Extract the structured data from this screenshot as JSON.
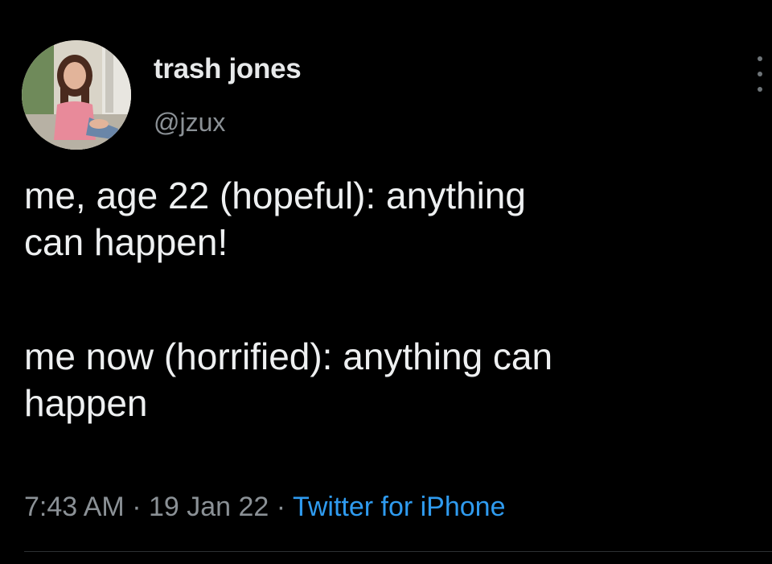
{
  "tweet": {
    "author": {
      "display_name": "trash jones",
      "handle": "@jzux",
      "avatar_icon": "profile-photo"
    },
    "text_lines": {
      "line1": "me, age 22 (hopeful): anything",
      "line2": "can happen!",
      "line3": "me now (horrified): anything can",
      "line4": "happen"
    },
    "meta": {
      "time": "7:43 AM",
      "separator": " · ",
      "date": "19 Jan 22",
      "source": "Twitter for iPhone"
    }
  },
  "colors": {
    "background": "#000000",
    "text_primary": "#e7e9ea",
    "text_secondary": "#8b9196",
    "link": "#2f9bef"
  },
  "icons": {
    "more": "more-options-icon"
  }
}
